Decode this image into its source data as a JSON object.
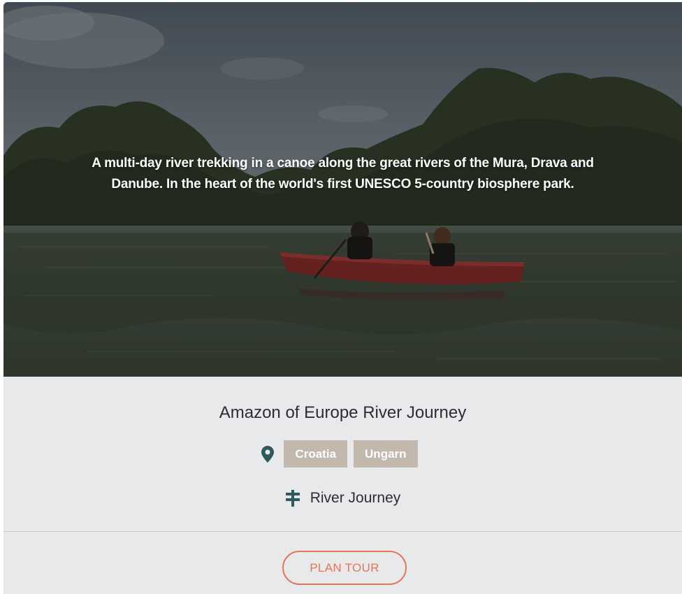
{
  "hero": {
    "description": "A multi-day river trekking in a canoe along the great rivers of the Mura, Drava and Danube. In the heart of the world's first UNESCO 5-country biosphere park."
  },
  "tour": {
    "title": "Amazon of Europe River Journey",
    "countries": [
      "Croatia",
      "Ungarn"
    ],
    "category": "River Journey"
  },
  "footer": {
    "plan_label": "PLAN TOUR"
  },
  "icons": {
    "location": "map-pin-icon",
    "category": "signpost-icon"
  },
  "colors": {
    "accent": "#e8735a",
    "tag_bg": "#c2b8ae",
    "icon": "#2d5a5b",
    "card_bg": "#e8e9ea"
  }
}
